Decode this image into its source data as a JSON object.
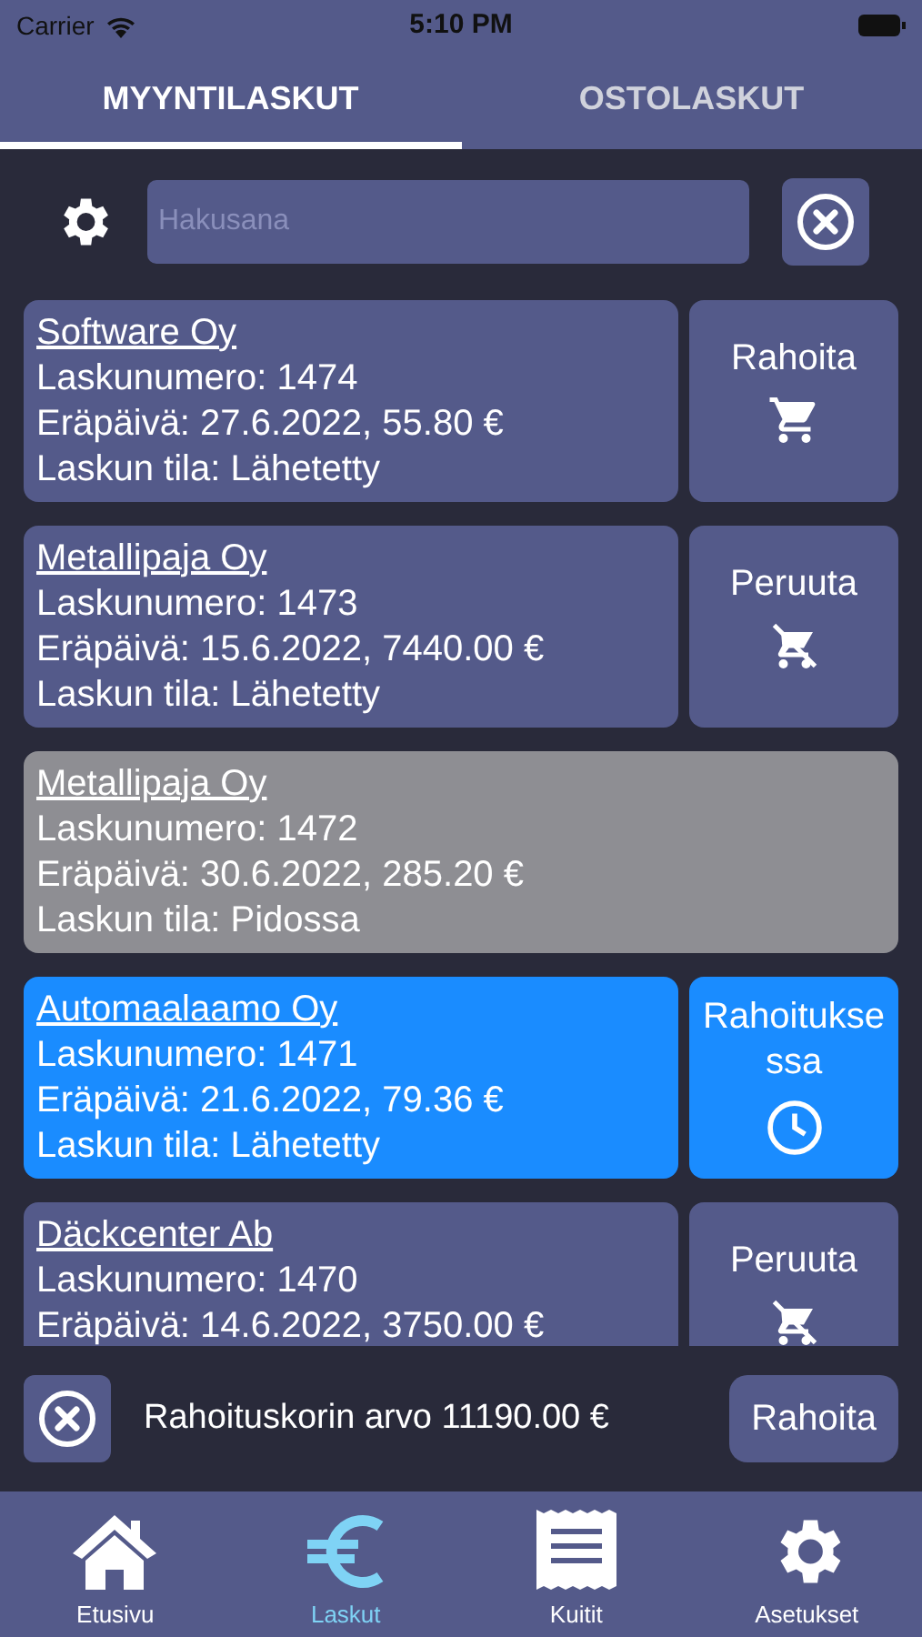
{
  "status_bar": {
    "carrier": "Carrier",
    "time": "5:10 PM"
  },
  "tabs": [
    {
      "label": "MYYNTILASKUT",
      "selected": true
    },
    {
      "label": "OSTOLASKUT",
      "selected": false
    }
  ],
  "search": {
    "placeholder": "Hakusana"
  },
  "invoices": [
    {
      "company": "Software Oy",
      "number": "Laskunumero: 1474",
      "due": "Eräpäivä: 27.6.2022, 55.80 €",
      "state": "Laskun tila: Lähetetty",
      "kind": "normal",
      "action": {
        "label": "Rahoita",
        "kind": "cart"
      }
    },
    {
      "company": "Metallipaja Oy",
      "number": "Laskunumero: 1473",
      "due": "Eräpäivä: 15.6.2022, 7440.00 €",
      "state": "Laskun tila: Lähetetty",
      "kind": "normal",
      "action": {
        "label": "Peruuta",
        "kind": "cart-off"
      }
    },
    {
      "company": "Metallipaja Oy",
      "number": "Laskunumero: 1472",
      "due": "Eräpäivä: 30.6.2022, 285.20 €",
      "state": "Laskun tila: Pidossa",
      "kind": "held"
    },
    {
      "company": "Automaalaamo Oy",
      "number": "Laskunumero: 1471",
      "due": "Eräpäivä: 21.6.2022, 79.36 €",
      "state": "Laskun tila: Lähetetty",
      "kind": "financing",
      "action": {
        "label": "Rahoitukse ssa",
        "kind": "clock"
      }
    },
    {
      "company": "Däckcenter Ab",
      "number": "Laskunumero: 1470",
      "due": "Eräpäivä: 14.6.2022, 3750.00 €",
      "kind": "normal",
      "action": {
        "label": "Peruuta",
        "kind": "cart-off"
      }
    }
  ],
  "basket": {
    "text": "Rahoituskorin arvo 11190.00 €",
    "button": "Rahoita"
  },
  "nav": [
    {
      "label": "Etusivu",
      "kind": "home",
      "selected": false
    },
    {
      "label": "Laskut",
      "kind": "euro",
      "selected": true
    },
    {
      "label": "Kuitit",
      "kind": "receipt",
      "selected": false
    },
    {
      "label": "Asetukset",
      "kind": "gear",
      "selected": false
    }
  ]
}
